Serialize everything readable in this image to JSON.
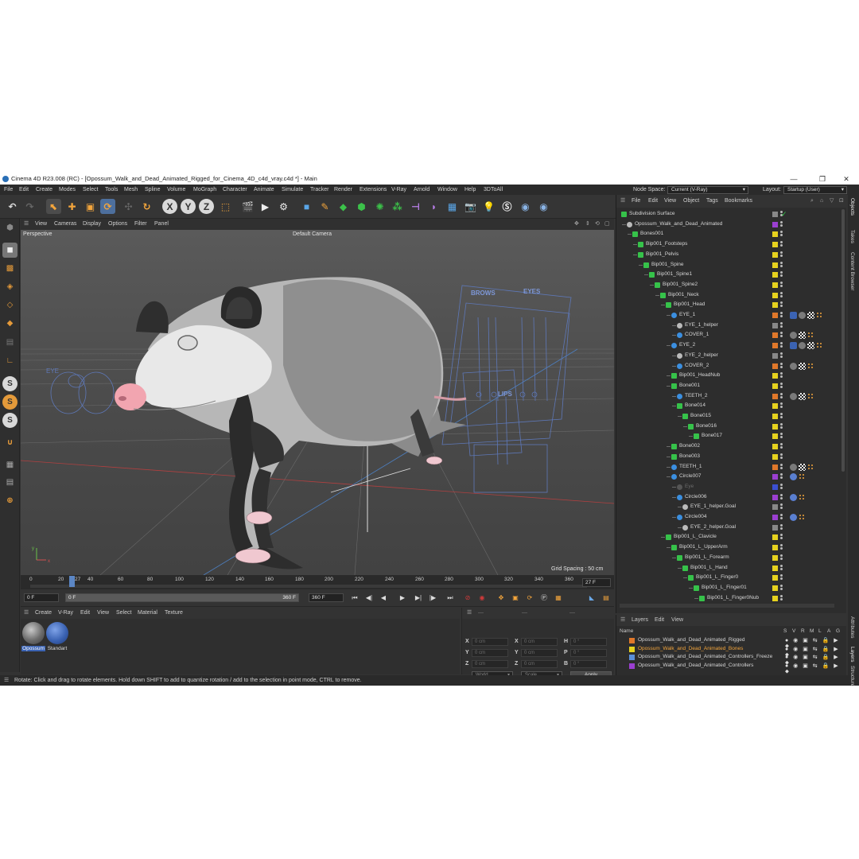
{
  "window": {
    "title": "Cinema 4D R23.008 (RC) - [Opossum_Walk_and_Dead_Animated_Rigged_for_Cinema_4D_c4d_vray.c4d *] - Main",
    "controls": [
      "—",
      "❐",
      "✕"
    ]
  },
  "menubar": {
    "items": [
      "File",
      "Edit",
      "Create",
      "Modes",
      "Select",
      "Tools",
      "Mesh",
      "Spline",
      "Volume",
      "MoGraph",
      "Character",
      "Animate",
      "Simulate",
      "Tracker",
      "Render",
      "Extensions",
      "V-Ray",
      "Arnold",
      "Window",
      "Help",
      "3DToAll"
    ],
    "node_space_label": "Node Space:",
    "node_space_value": "Current (V-Ray)",
    "layout_label": "Layout:",
    "layout_value": "Startup (User)"
  },
  "toolbar": {
    "axis_x": "X",
    "axis_y": "Y",
    "axis_z": "Z"
  },
  "viewport": {
    "menu": [
      "View",
      "Cameras",
      "Display",
      "Options",
      "Filter",
      "Panel"
    ],
    "projection": "Perspective",
    "camera": "Default Camera",
    "grid_spacing": "Grid Spacing : 50 cm",
    "guide_labels": {
      "brows": "BROWS",
      "eyes": "EYES",
      "lips": "LIPS",
      "eye": "EYE"
    },
    "axis_x": "x",
    "axis_y": "y"
  },
  "timeline": {
    "ticks": [
      "0",
      "20",
      "40",
      "60",
      "80",
      "100",
      "120",
      "140",
      "160",
      "180",
      "200",
      "220",
      "240",
      "260",
      "280",
      "300",
      "320",
      "340",
      "360"
    ],
    "current_marker": "27",
    "current_frame_field": "27 F"
  },
  "transport": {
    "start_field": "0 F",
    "current_field": "0 F",
    "end_field_a": "360 F",
    "end_field_b": "360 F"
  },
  "material_panel": {
    "menu": [
      "Create",
      "V-Ray",
      "Edit",
      "View",
      "Select",
      "Material",
      "Texture"
    ],
    "materials": [
      {
        "label": "Opossum",
        "color": "#7b7b7b"
      },
      {
        "label": "Standart",
        "color": "#3b63b3"
      }
    ]
  },
  "coordinates": {
    "rows": [
      {
        "a": "X",
        "av": "0 cm",
        "b": "X",
        "bv": "0 cm",
        "c": "H",
        "cv": "0 °"
      },
      {
        "a": "Y",
        "av": "0 cm",
        "b": "Y",
        "bv": "0 cm",
        "c": "P",
        "cv": "0 °"
      },
      {
        "a": "Z",
        "av": "0 cm",
        "b": "Z",
        "bv": "0 cm",
        "c": "B",
        "cv": "0 °"
      }
    ],
    "mode_world": "World",
    "mode_scale": "Scale",
    "apply": "Apply"
  },
  "status": {
    "text": "Rotate: Click and drag to rotate elements. Hold down SHIFT to add to quantize rotation / add to the selection in point mode, CTRL to remove."
  },
  "objects": {
    "menu": [
      "File",
      "Edit",
      "View",
      "Object",
      "Tags",
      "Bookmarks"
    ],
    "rows": [
      {
        "name": "Subdivision Surface",
        "depth": 0,
        "color": "#888888",
        "icon": "#36c24a",
        "tags": [
          "check"
        ]
      },
      {
        "name": "Opossum_Walk_and_Dead_Animated",
        "depth": 1,
        "color": "#9b3fd1",
        "icon": "#bbbbbb",
        "tags": []
      },
      {
        "name": "Bones001",
        "depth": 2,
        "color": "#e6d21e",
        "icon": "#36c24a",
        "tags": []
      },
      {
        "name": "Bip001_Footsteps",
        "depth": 3,
        "color": "#e6d21e",
        "icon": "#36c24a",
        "tags": []
      },
      {
        "name": "Bip001_Pelvis",
        "depth": 3,
        "color": "#e6d21e",
        "icon": "#36c24a",
        "tags": []
      },
      {
        "name": "Bip001_Spine",
        "depth": 4,
        "color": "#e6d21e",
        "icon": "#36c24a",
        "tags": []
      },
      {
        "name": "Bip001_Spine1",
        "depth": 5,
        "color": "#e6d21e",
        "icon": "#36c24a",
        "tags": []
      },
      {
        "name": "Bip001_Spine2",
        "depth": 6,
        "color": "#e6d21e",
        "icon": "#36c24a",
        "tags": []
      },
      {
        "name": "Bip001_Neck",
        "depth": 7,
        "color": "#e6d21e",
        "icon": "#36c24a",
        "tags": []
      },
      {
        "name": "Bip001_Head",
        "depth": 8,
        "color": "#e6d21e",
        "icon": "#36c24a",
        "tags": []
      },
      {
        "name": "EYE_1",
        "depth": 9,
        "color": "#e0782a",
        "icon": "#3b8fe0",
        "tags": [
          "blue",
          "sphere",
          "checker",
          "dots"
        ]
      },
      {
        "name": "EYE_1_helper",
        "depth": 10,
        "color": "#888888",
        "icon": "#bbbbbb",
        "tags": []
      },
      {
        "name": "COVER_1",
        "depth": 10,
        "color": "#e0782a",
        "icon": "#3b8fe0",
        "tags": [
          "sphere",
          "checker",
          "dots"
        ]
      },
      {
        "name": "EYE_2",
        "depth": 9,
        "color": "#e0782a",
        "icon": "#3b8fe0",
        "tags": [
          "blue",
          "sphere",
          "checker",
          "dots"
        ]
      },
      {
        "name": "EYE_2_helper",
        "depth": 10,
        "color": "#888888",
        "icon": "#bbbbbb",
        "tags": []
      },
      {
        "name": "COVER_2",
        "depth": 10,
        "color": "#e0782a",
        "icon": "#3b8fe0",
        "tags": [
          "sphere",
          "checker",
          "dots"
        ]
      },
      {
        "name": "Bip001_HeadNub",
        "depth": 9,
        "color": "#e6d21e",
        "icon": "#36c24a",
        "tags": []
      },
      {
        "name": "Bone001",
        "depth": 9,
        "color": "#e6d21e",
        "icon": "#36c24a",
        "tags": []
      },
      {
        "name": "TEETH_2",
        "depth": 10,
        "color": "#e0782a",
        "icon": "#3b8fe0",
        "tags": [
          "sphere",
          "checker",
          "dots"
        ]
      },
      {
        "name": "Bone014",
        "depth": 10,
        "color": "#e6d21e",
        "icon": "#36c24a",
        "tags": []
      },
      {
        "name": "Bone015",
        "depth": 11,
        "color": "#e6d21e",
        "icon": "#36c24a",
        "tags": []
      },
      {
        "name": "Bone016",
        "depth": 12,
        "color": "#e6d21e",
        "icon": "#36c24a",
        "tags": []
      },
      {
        "name": "Bone017",
        "depth": 13,
        "color": "#e6d21e",
        "icon": "#36c24a",
        "tags": []
      },
      {
        "name": "Bone002",
        "depth": 9,
        "color": "#e6d21e",
        "icon": "#36c24a",
        "tags": []
      },
      {
        "name": "Bone003",
        "depth": 9,
        "color": "#e6d21e",
        "icon": "#36c24a",
        "tags": []
      },
      {
        "name": "TEETH_1",
        "depth": 9,
        "color": "#e0782a",
        "icon": "#3b8fe0",
        "tags": [
          "sphere",
          "checker",
          "dots"
        ]
      },
      {
        "name": "Circle007",
        "depth": 9,
        "color": "#9b3fd1",
        "icon": "#3b8fe0",
        "tags": [
          "ball",
          "dots"
        ]
      },
      {
        "name": "Eye",
        "depth": 10,
        "color": "#3b4fd1",
        "icon": "#555555",
        "tags": [],
        "dim": true
      },
      {
        "name": "Circle006",
        "depth": 10,
        "color": "#9b3fd1",
        "icon": "#3b8fe0",
        "tags": [
          "ball",
          "dots"
        ]
      },
      {
        "name": "EYE_1_helper.Goal",
        "depth": 11,
        "color": "#888888",
        "icon": "#bbbbbb",
        "tags": []
      },
      {
        "name": "Circle004",
        "depth": 10,
        "color": "#9b3fd1",
        "icon": "#3b8fe0",
        "tags": [
          "ball",
          "dots"
        ]
      },
      {
        "name": "EYE_2_helper.Goal",
        "depth": 11,
        "color": "#888888",
        "icon": "#bbbbbb",
        "tags": []
      },
      {
        "name": "Bip001_L_Clavicle",
        "depth": 8,
        "color": "#e6d21e",
        "icon": "#36c24a",
        "tags": []
      },
      {
        "name": "Bip001_L_UpperArm",
        "depth": 9,
        "color": "#e6d21e",
        "icon": "#36c24a",
        "tags": []
      },
      {
        "name": "Bip001_L_Forearm",
        "depth": 10,
        "color": "#e6d21e",
        "icon": "#36c24a",
        "tags": []
      },
      {
        "name": "Bip001_L_Hand",
        "depth": 11,
        "color": "#e6d21e",
        "icon": "#36c24a",
        "tags": []
      },
      {
        "name": "Bip001_L_Finger0",
        "depth": 12,
        "color": "#e6d21e",
        "icon": "#36c24a",
        "tags": []
      },
      {
        "name": "Bip001_L_Finger01",
        "depth": 13,
        "color": "#e6d21e",
        "icon": "#36c24a",
        "tags": []
      },
      {
        "name": "Bip001_L_Finger0Nub",
        "depth": 14,
        "color": "#e6d21e",
        "icon": "#36c24a",
        "tags": []
      }
    ]
  },
  "layers": {
    "menu": [
      "Layers",
      "Edit",
      "View"
    ],
    "name_header": "Name",
    "col_headers": [
      "S",
      "V",
      "R",
      "M",
      "L",
      "A",
      "G",
      "X"
    ],
    "rows": [
      {
        "name": "Opossum_Walk_and_Dead_Animated_Rigged",
        "color": "#e0782a",
        "highlight": false
      },
      {
        "name": "Opossum_Walk_and_Dead_Animated_Bones",
        "color": "#e6d21e",
        "highlight": true
      },
      {
        "name": "Opossum_Walk_and_Dead_Animated_Controllers_Freeze",
        "color": "#5a8fd8",
        "highlight": false
      },
      {
        "name": "Opossum_Walk_and_Dead_Animated_Controllers",
        "color": "#9b3fd1",
        "highlight": false
      }
    ]
  },
  "side_tabs": [
    "Objects",
    "Takes",
    "Content Browser",
    "Attributes",
    "Layers",
    "Structure"
  ]
}
